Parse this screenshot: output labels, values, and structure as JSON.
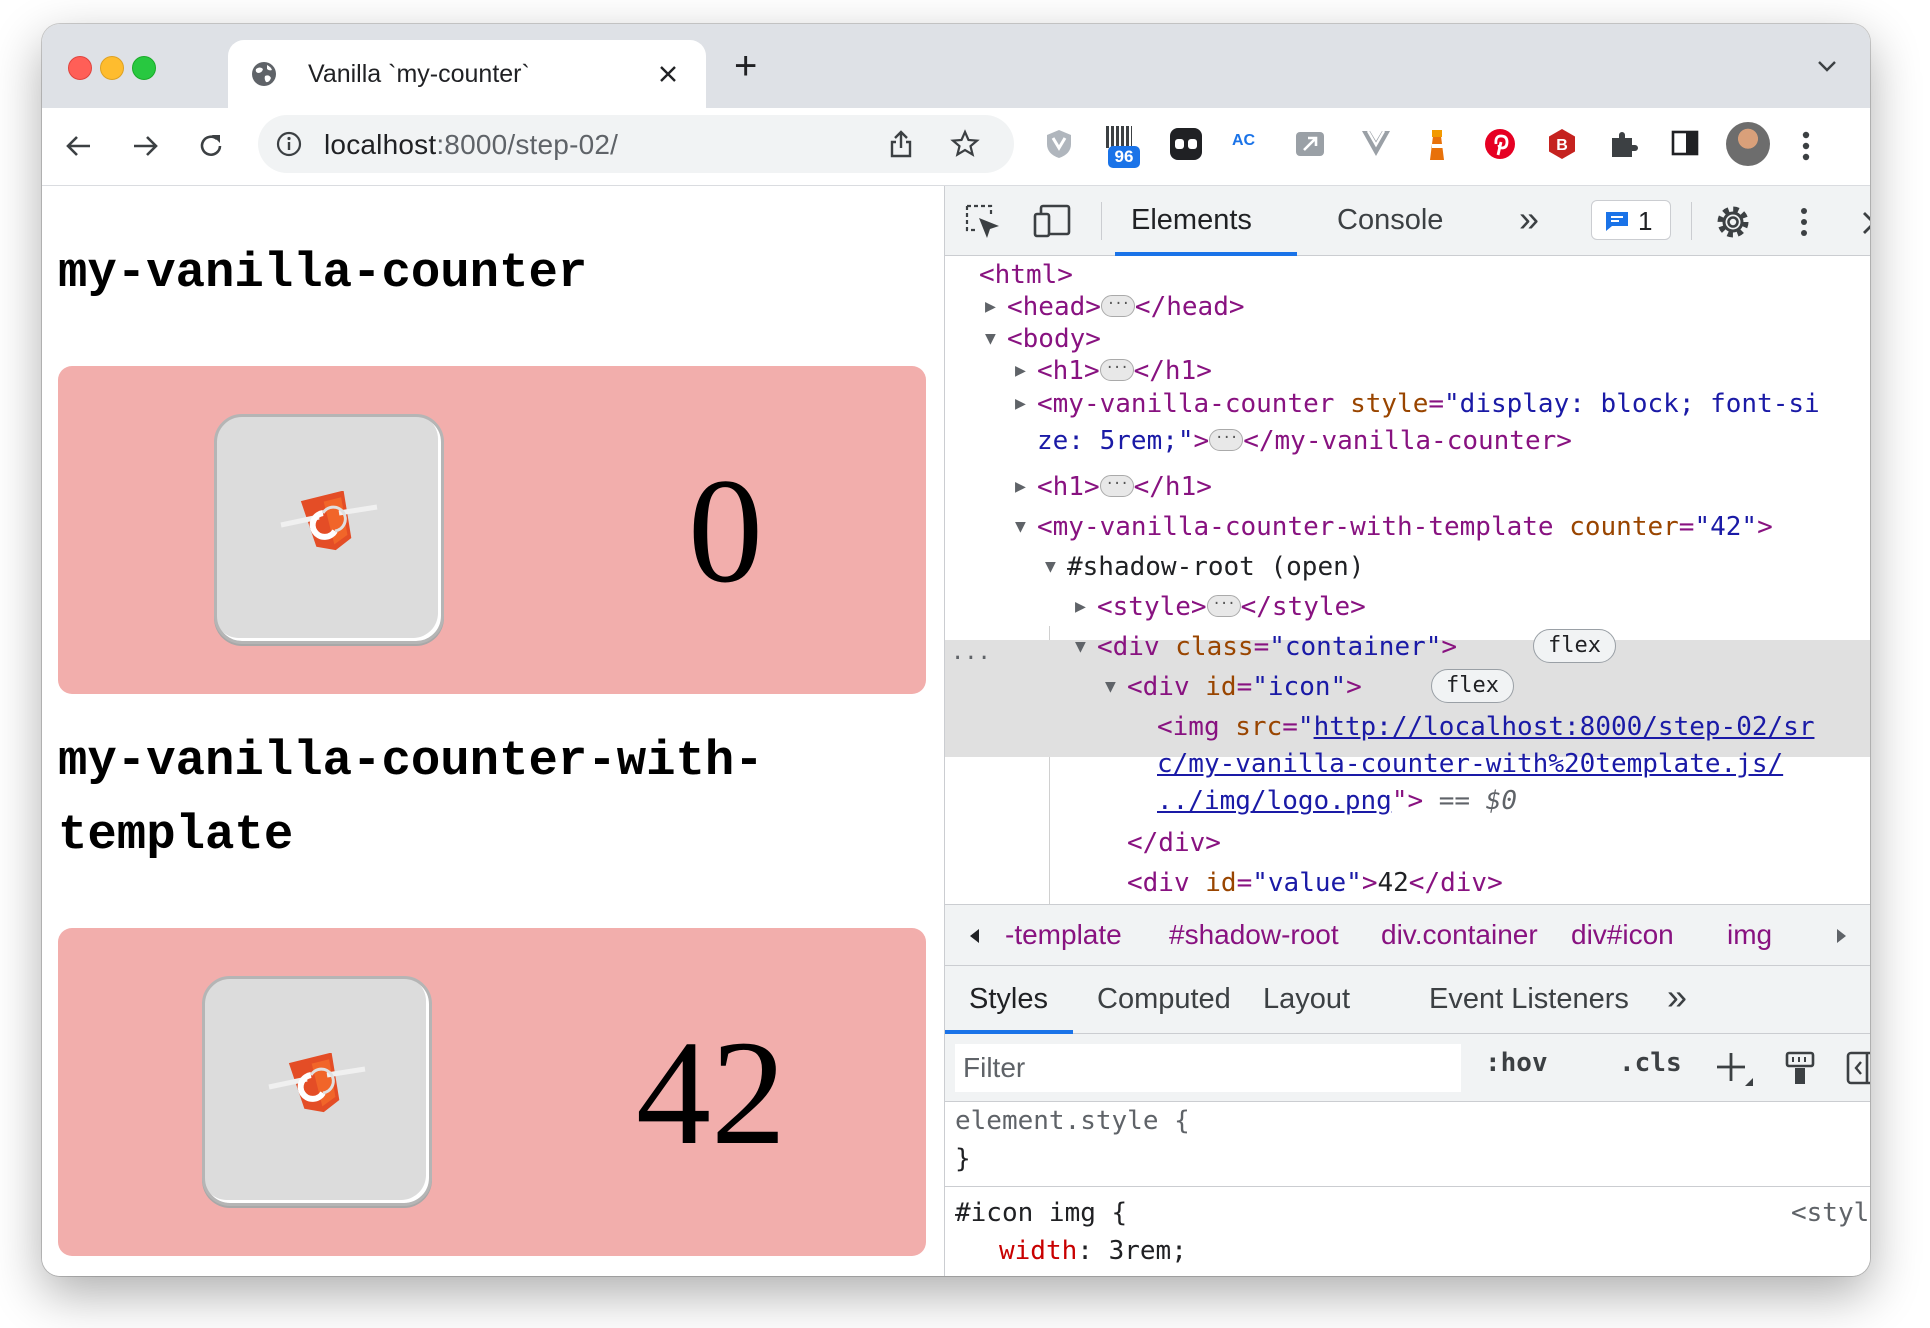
{
  "browser": {
    "tab_title": "Vanilla `my-counter`",
    "new_tab": "+",
    "url_host": "localhost",
    "url_path": ":8000/step-02/",
    "extension_badge": "96"
  },
  "page": {
    "heading1": "my-vanilla-counter",
    "counter1": "0",
    "heading2_line1": "my-vanilla-counter-with-",
    "heading2_line2": "template",
    "counter2": "42"
  },
  "devtools": {
    "tabs": [
      "Elements",
      "Console"
    ],
    "more_tabs": "»",
    "issues_count": "1",
    "dom": {
      "html_open": "<html>",
      "head_open": "<head>",
      "head_close": "</head>",
      "body_open": "<body>",
      "h1_open": "<h1>",
      "h1_close": "</h1>",
      "mvc_open": "<my-vanilla-counter",
      "mvc_attr": "style",
      "mvc_val1": "\"display: block; font-si",
      "mvc_val2": "ze: 5rem;\"",
      "mvc_gt": ">",
      "mvc_close": "</my-vanilla-counter>",
      "mvct_open": "<my-vanilla-counter-with-template",
      "mvct_attr": "counter",
      "mvct_val": "\"42\"",
      "shadow_root": "#shadow-root",
      "shadow_mode": "(open)",
      "style_open": "<style>",
      "style_close": "</style>",
      "div_open": "<div",
      "class_attr": "class",
      "class_val": "\"container\"",
      "id_attr": "id",
      "icon_val": "\"icon\"",
      "flex_badge": "flex",
      "img_open": "<img",
      "src_attr": "src",
      "src_q": "\"",
      "src1": "http://localhost:8000/step-02/sr",
      "src2": "c/my-vanilla-counter-with%20template.js/",
      "src3": "../img/logo.png",
      "img_end": "\">",
      "selected_marker": "== $0",
      "div_close": "</div>",
      "value_val": "\"value\"",
      "value_text": "42",
      "eq": "=",
      "gt": ">",
      "ellipsis": "···"
    },
    "breadcrumbs": [
      "-template",
      "#shadow-root",
      "div.container",
      "div#icon",
      "img"
    ],
    "subtabs": [
      "Styles",
      "Computed",
      "Layout",
      "Event Listeners"
    ],
    "filter_placeholder": "Filter",
    "hov": ":hov",
    "cls": ".cls",
    "rules": {
      "element_style": "element.style {",
      "close_brace": "}",
      "selector": "#icon img {",
      "source": "<style>",
      "prop": "width",
      "val": " 3rem;"
    }
  },
  "colors": {
    "card_bg": "#f2aeac",
    "tag": "#881280",
    "attr_name": "#994500",
    "attr_value": "#1a1aa6",
    "accent": "#1a73e8"
  }
}
